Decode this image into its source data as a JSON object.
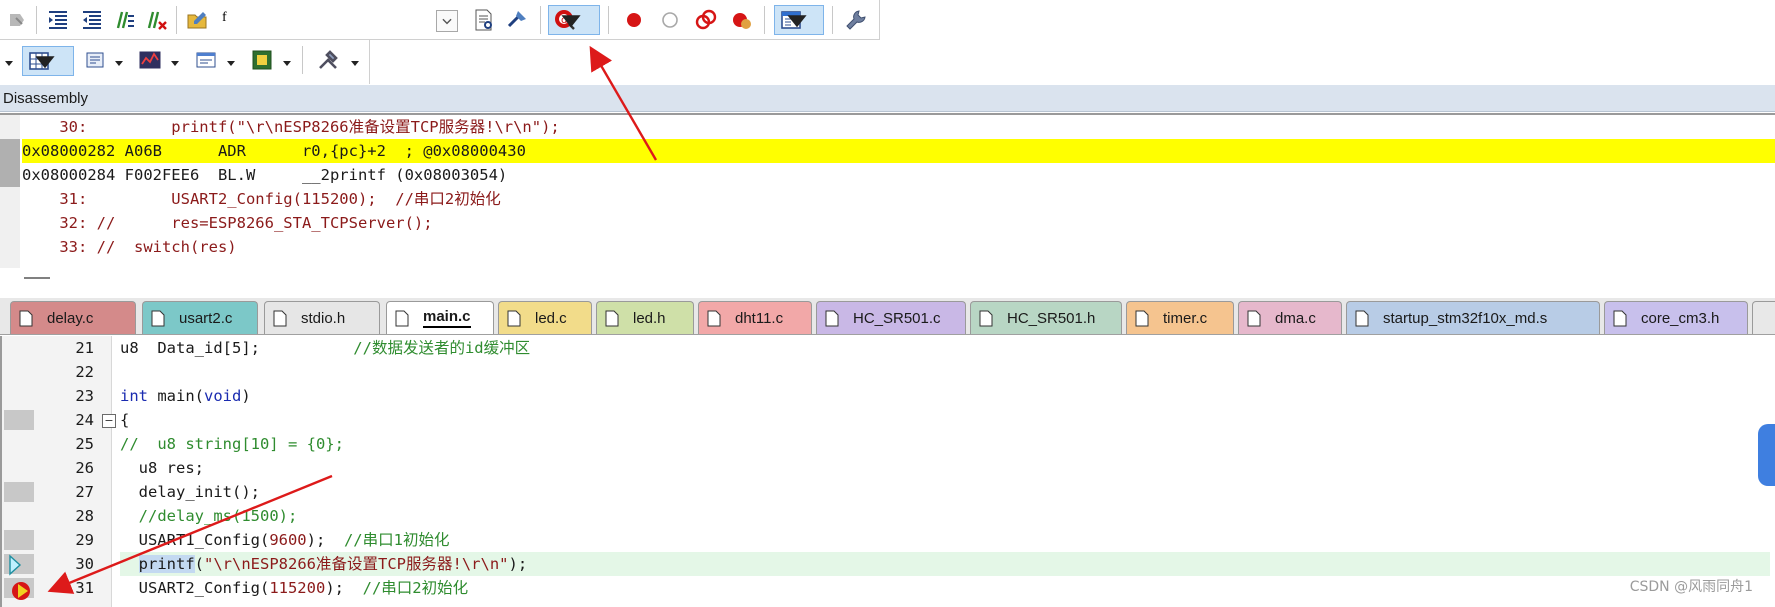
{
  "toolbar": {
    "text_glyph": "f",
    "accent": "#cc0000"
  },
  "disassembly": {
    "title": "Disassembly",
    "lines": [
      {
        "text": "    30:         printf(\"\\r\\nESP8266准备设置TCP服务器!\\r\\n\");",
        "kind": "src"
      },
      {
        "text": "0x08000282 A06B      ADR      r0,{pc}+2  ; @0x08000430",
        "kind": "asm-hl"
      },
      {
        "text": "0x08000284 F002FEE6  BL.W     __2printf (0x08003054)",
        "kind": "asm"
      },
      {
        "text": "    31:         USART2_Config(115200);  //串口2初始化",
        "kind": "src"
      },
      {
        "text": "    32: //      res=ESP8266_STA_TCPServer();",
        "kind": "src"
      },
      {
        "text": "    33: //  switch(res)",
        "kind": "src"
      }
    ]
  },
  "tabs": [
    {
      "label": "delay.c",
      "color": "#d48a8a"
    },
    {
      "label": "usart2.c",
      "color": "#7cc8c8"
    },
    {
      "label": "stdio.h",
      "color": "#e6e6e6"
    },
    {
      "label": "main.c",
      "color": "#ffffff",
      "active": true
    },
    {
      "label": "led.c",
      "color": "#f2dc8a"
    },
    {
      "label": "led.h",
      "color": "#cfe0a8"
    },
    {
      "label": "dht11.c",
      "color": "#f2a8a8"
    },
    {
      "label": "HC_SR501.c",
      "color": "#c9b8e6"
    },
    {
      "label": "HC_SR501.h",
      "color": "#b8d6c4"
    },
    {
      "label": "timer.c",
      "color": "#f5c48f"
    },
    {
      "label": "dma.c",
      "color": "#e6b8cc"
    },
    {
      "label": "startup_stm32f10x_md.s",
      "color": "#b8cce6"
    },
    {
      "label": "core_cm3.h",
      "color": "#c8c0ec"
    }
  ],
  "editor": {
    "line_numbers": [
      "21",
      "22",
      "23",
      "24",
      "25",
      "26",
      "27",
      "28",
      "29",
      "30",
      "31"
    ],
    "current_line": "30",
    "breakpoint_line": "31"
  },
  "watermark": "CSDN @风雨同舟1"
}
